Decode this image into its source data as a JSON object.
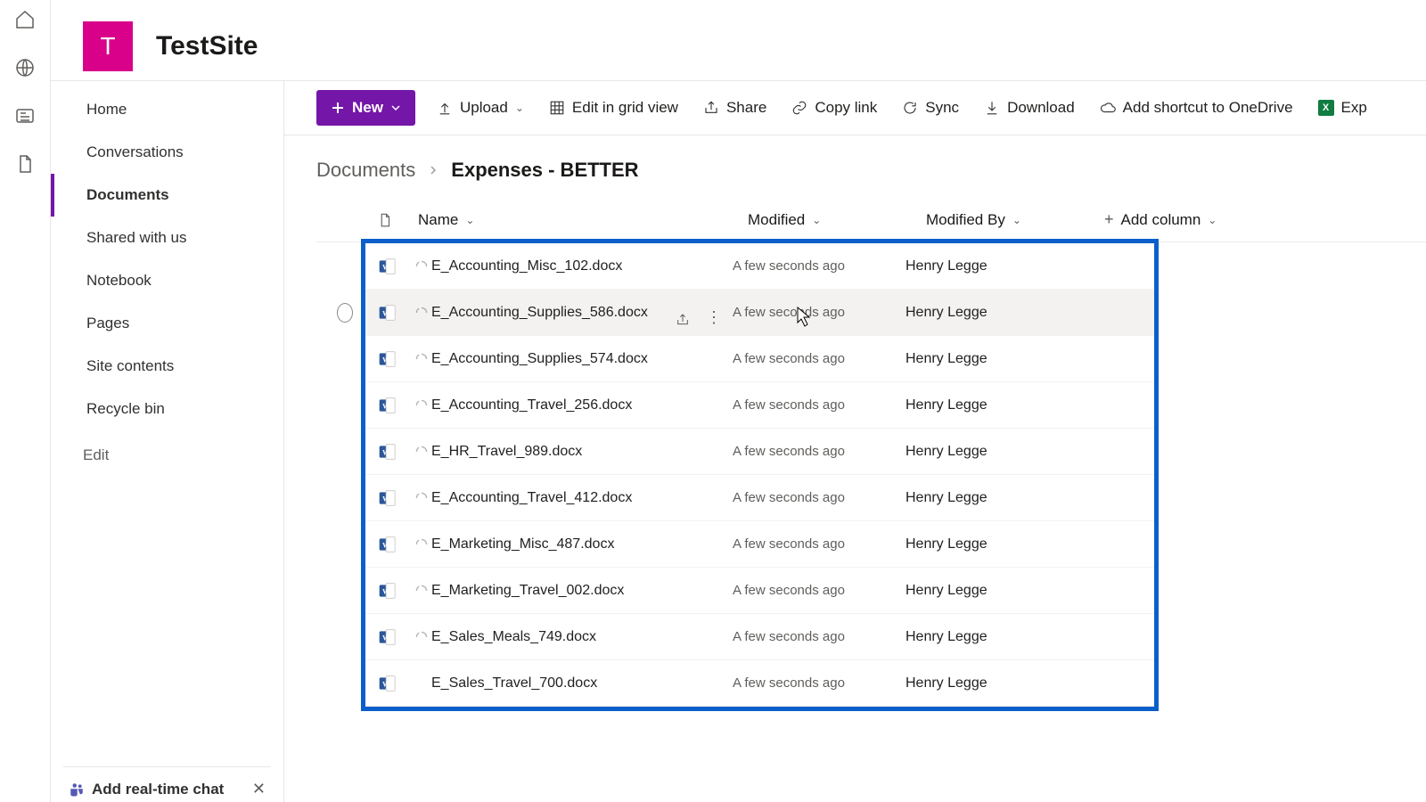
{
  "site": {
    "initial": "T",
    "title": "TestSite"
  },
  "rail": {
    "icons": [
      "home-icon",
      "globe-icon",
      "news-icon",
      "file-icon"
    ]
  },
  "nav": {
    "items": [
      {
        "label": "Home"
      },
      {
        "label": "Conversations"
      },
      {
        "label": "Documents",
        "selected": true
      },
      {
        "label": "Shared with us"
      },
      {
        "label": "Notebook"
      },
      {
        "label": "Pages"
      },
      {
        "label": "Site contents"
      },
      {
        "label": "Recycle bin"
      }
    ],
    "edit_label": "Edit"
  },
  "chat_callout": {
    "title": "Add real-time chat"
  },
  "toolbar": {
    "new_label": "New",
    "upload_label": "Upload",
    "grid_label": "Edit in grid view",
    "share_label": "Share",
    "copy_label": "Copy link",
    "sync_label": "Sync",
    "download_label": "Download",
    "shortcut_label": "Add shortcut to OneDrive",
    "export_label": "Exp"
  },
  "breadcrumb": {
    "root": "Documents",
    "current": "Expenses - BETTER"
  },
  "columns": {
    "name": "Name",
    "modified": "Modified",
    "modified_by": "Modified By",
    "add": "Add column"
  },
  "files": [
    {
      "name": "E_Accounting_Misc_102.docx",
      "modified": "A few seconds ago",
      "by": "Henry Legge",
      "loading": true
    },
    {
      "name": "E_Accounting_Supplies_586.docx",
      "modified": "A few seconds ago",
      "by": "Henry Legge",
      "loading": true,
      "hovered": true
    },
    {
      "name": "E_Accounting_Supplies_574.docx",
      "modified": "A few seconds ago",
      "by": "Henry Legge",
      "loading": true
    },
    {
      "name": "E_Accounting_Travel_256.docx",
      "modified": "A few seconds ago",
      "by": "Henry Legge",
      "loading": true
    },
    {
      "name": "E_HR_Travel_989.docx",
      "modified": "A few seconds ago",
      "by": "Henry Legge",
      "loading": true
    },
    {
      "name": "E_Accounting_Travel_412.docx",
      "modified": "A few seconds ago",
      "by": "Henry Legge",
      "loading": true
    },
    {
      "name": "E_Marketing_Misc_487.docx",
      "modified": "A few seconds ago",
      "by": "Henry Legge",
      "loading": true
    },
    {
      "name": "E_Marketing_Travel_002.docx",
      "modified": "A few seconds ago",
      "by": "Henry Legge",
      "loading": true
    },
    {
      "name": "E_Sales_Meals_749.docx",
      "modified": "A few seconds ago",
      "by": "Henry Legge",
      "loading": true
    },
    {
      "name": "E_Sales_Travel_700.docx",
      "modified": "A few seconds ago",
      "by": "Henry Legge",
      "loading": false
    }
  ]
}
